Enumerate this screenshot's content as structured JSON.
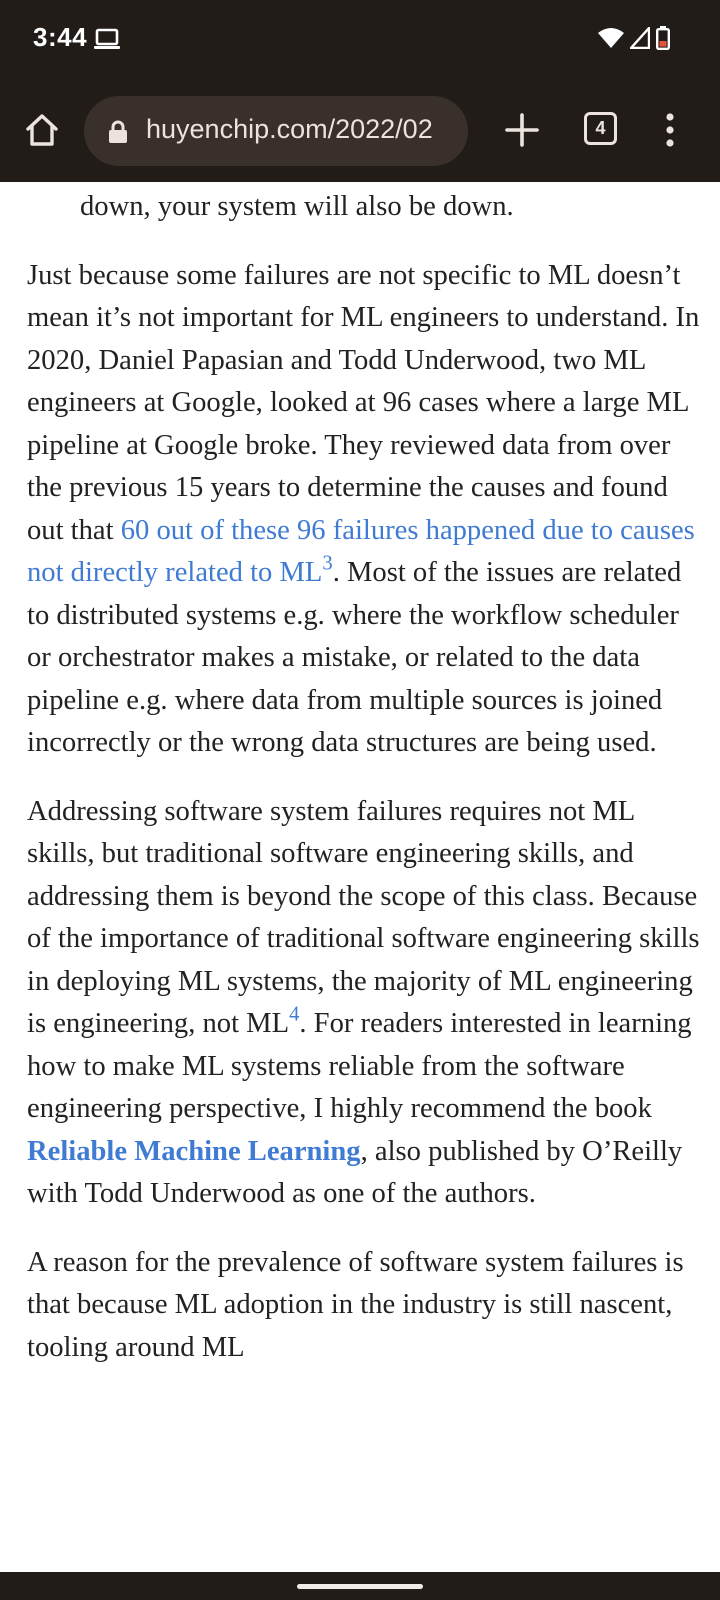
{
  "status_bar": {
    "time": "3:44"
  },
  "browser": {
    "url": "huyenchip.com/2022/02",
    "tab_count": "4"
  },
  "article": {
    "continuation": "down, your system will also be down.",
    "p1": {
      "before_link": "Just because some failures are not specific to ML doesn’t mean it’s not important for ML engineers to understand. In 2020, Daniel Papasian and Todd Underwood, two ML engineers at Google, looked at 96 cases where a large ML pipeline at Google broke. They reviewed data from over the previous 15 years to determine the causes and found out that ",
      "link": "60 out of these 96 failures happened due to causes not directly related to ML",
      "footnote": "3",
      "after_link": ". Most of the issues are related to distributed systems e.g. where the workflow scheduler or orchestrator makes a mistake, or related to the data pipeline e.g. where data from multiple sources is joined incorrectly or the wrong data structures are being used."
    },
    "p2": {
      "before_footnote": "Addressing software system failures requires not ML skills, but traditional software engineering skills, and addressing them is beyond the scope of this class. Because of the importance of traditional software engineering skills in deploying ML systems, the majority of ML engineering is engineering, not ML",
      "footnote": "4",
      "middle": ". For readers interested in learning how to make ML systems reliable from the software engineering perspective, I highly recommend the book ",
      "book_link": "Reliable Machine Learning",
      "after_link": ", also published by O’Reilly with Todd Underwood as one of the authors."
    },
    "p3": "A reason for the prevalence of software system failures is that because ML adoption in the industry is still nascent, tooling around ML"
  },
  "colors": {
    "chrome_bg": "#221c19",
    "url_pill_bg": "#3a302b",
    "link": "#3f7bd3",
    "body_text": "#222222"
  }
}
